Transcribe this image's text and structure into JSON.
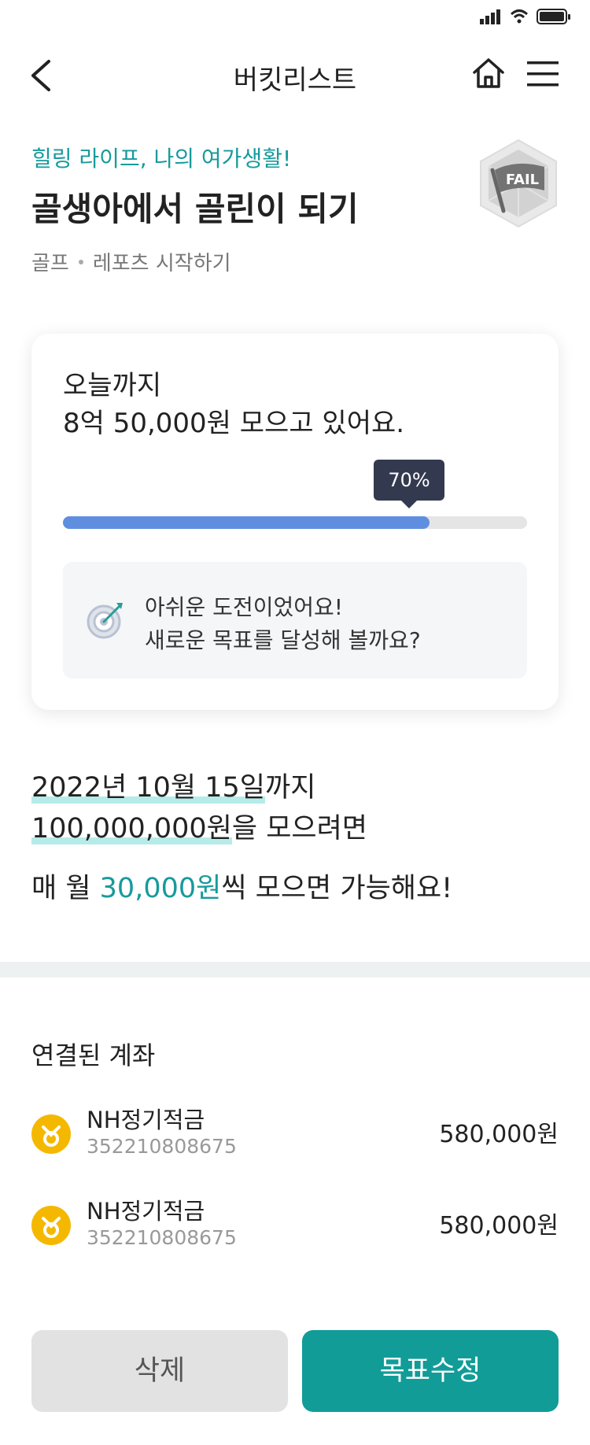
{
  "header": {
    "title": "버킷리스트"
  },
  "goal": {
    "category": "힐링 라이프, 나의 여가생활!",
    "title": "골생아에서 골린이 되기",
    "tags": [
      "골프",
      "레포츠 시작하기"
    ],
    "badge_text": "FAIL"
  },
  "progress_card": {
    "line1": "오늘까지",
    "line2": "8억 50,000원 모으고 있어요.",
    "percent_label": "70%",
    "percent_value": 0.79,
    "message_line1": "아쉬운 도전이었어요!",
    "message_line2": "새로운 목표를 달성해 볼까요?"
  },
  "plan": {
    "date": "2022년 10월 15일",
    "date_suffix": "까지",
    "amount": "100,000,000원",
    "amount_suffix": "을 모으려면",
    "monthly_prefix": "매 월 ",
    "monthly_amount": "30,000원",
    "monthly_suffix": "씩 모으면 가능해요!"
  },
  "accounts": {
    "title": "연결된 계좌",
    "items": [
      {
        "name": "NH정기적금",
        "number": "352210808675",
        "amount": "580,000원"
      },
      {
        "name": "NH정기적금",
        "number": "352210808675",
        "amount": "580,000원"
      }
    ]
  },
  "buttons": {
    "delete": "삭제",
    "edit": "목표수정"
  },
  "colors": {
    "teal": "#179a9c",
    "progress": "#5f8ee0",
    "tooltip": "#333a50",
    "coin": "#f5b800"
  }
}
